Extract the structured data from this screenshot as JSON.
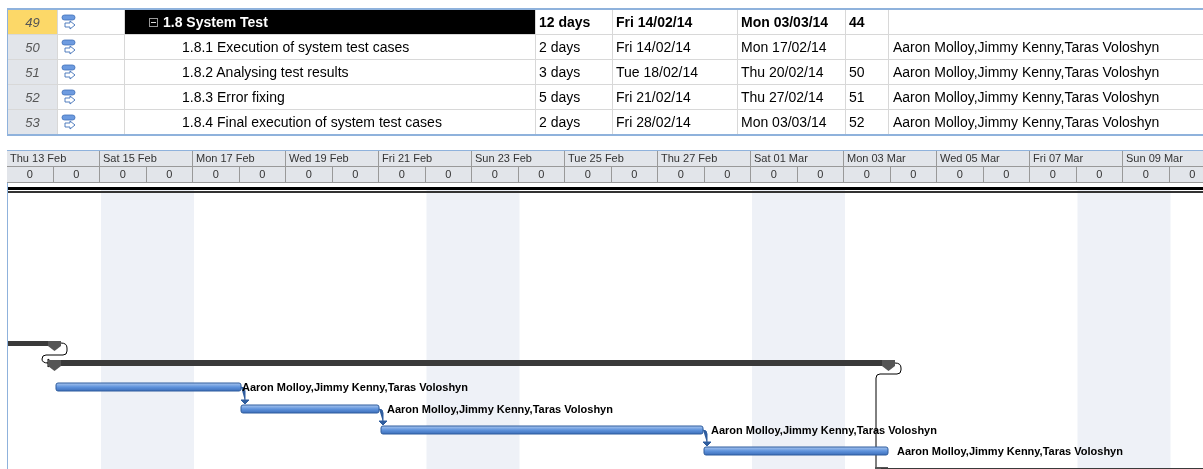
{
  "rows": [
    {
      "id": "49",
      "kind": "summary",
      "selected": true,
      "expanded": true,
      "name": "1.8 System Test",
      "duration": "12 days",
      "start": "Fri 14/02/14",
      "finish": "Mon 03/03/14",
      "predecessors": "44"
    },
    {
      "id": "50",
      "kind": "task",
      "selected": false,
      "name": "1.8.1 Execution of system test cases",
      "duration": "2 days",
      "start": "Fri 14/02/14",
      "finish": "Mon 17/02/14",
      "resources": "Aaron Molloy,Jimmy Kenny,Taras Voloshyn"
    },
    {
      "id": "51",
      "kind": "task",
      "selected": false,
      "name": "1.8.2 Analysing test results",
      "duration": "3 days",
      "start": "Tue 18/02/14",
      "finish": "Thu 20/02/14",
      "predecessors": "50",
      "resources": "Aaron Molloy,Jimmy Kenny,Taras Voloshyn"
    },
    {
      "id": "52",
      "kind": "task",
      "selected": false,
      "name": "1.8.3 Error fixing",
      "duration": "5 days",
      "start": "Fri 21/02/14",
      "finish": "Thu 27/02/14",
      "predecessors": "51",
      "resources": "Aaron Molloy,Jimmy Kenny,Taras Voloshyn"
    },
    {
      "id": "53",
      "kind": "task",
      "selected": false,
      "name": "1.8.4 Final execution of system test cases",
      "duration": "2 days",
      "start": "Fri 28/02/14",
      "finish": "Mon 03/03/14",
      "predecessors": "52",
      "resources": "Aaron Molloy,Jimmy Kenny,Taras Voloshyn"
    }
  ],
  "timescale": {
    "major": [
      "Thu 13 Feb",
      "Sat 15 Feb",
      "Mon 17 Feb",
      "Wed 19 Feb",
      "Fri 21 Feb",
      "Sun 23 Feb",
      "Tue 25 Feb",
      "Thu 27 Feb",
      "Sat 01 Mar",
      "Mon 03 Mar",
      "Wed 05 Mar",
      "Fri 07 Mar",
      "Sun 09 Mar"
    ],
    "minor": [
      "0",
      "0",
      "0",
      "0",
      "0",
      "0",
      "0",
      "0",
      "0",
      "0",
      "0",
      "0",
      "0",
      "0",
      "0",
      "0",
      "0",
      "0",
      "0",
      "0",
      "0",
      "0",
      "0",
      "0",
      "0",
      "0"
    ]
  },
  "gantt": {
    "bar_labels": [
      "Aaron Molloy,Jimmy Kenny,Taras Voloshyn",
      "Aaron Molloy,Jimmy Kenny,Taras Voloshyn",
      "Aaron Molloy,Jimmy Kenny,Taras Voloshyn",
      "Aaron Molloy,Jimmy Kenny,Taras Voloshyn"
    ]
  }
}
